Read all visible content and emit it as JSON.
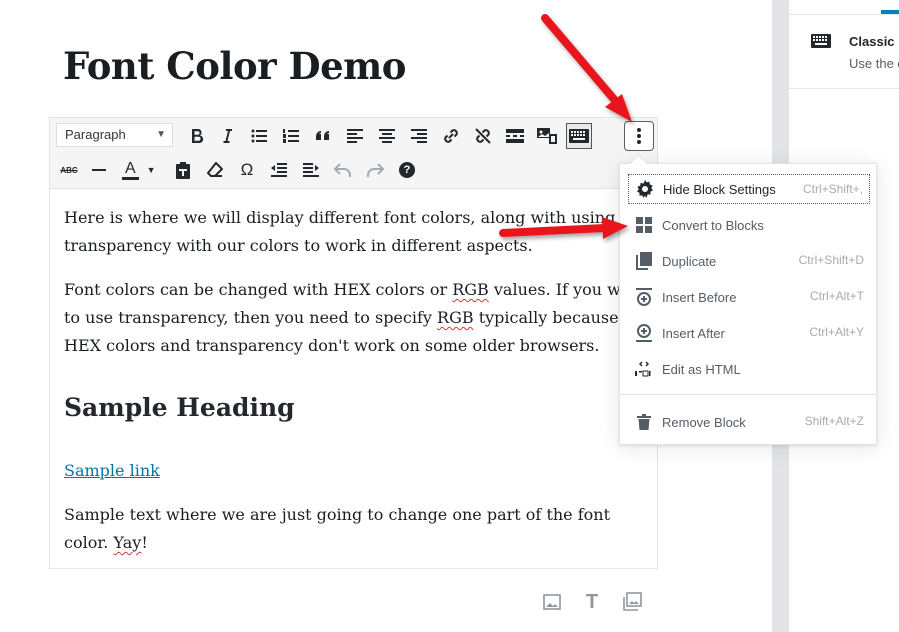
{
  "post": {
    "title": "Font Color Demo"
  },
  "toolbar": {
    "format_select": "Paragraph",
    "row1_icons": [
      "bold-icon",
      "italic-icon",
      "bullet-list-icon",
      "numbered-list-icon",
      "blockquote-icon",
      "align-left-icon",
      "align-center-icon",
      "align-right-icon",
      "link-icon",
      "unlink-icon",
      "read-more-icon",
      "media-icon",
      "toolbar-toggle-icon"
    ],
    "row2_icons": [
      "strikethrough-icon",
      "horizontal-line-icon",
      "text-color-icon",
      "paste-text-icon",
      "clear-formatting-icon",
      "special-character-icon",
      "outdent-icon",
      "indent-icon",
      "undo-icon",
      "redo-icon",
      "help-icon"
    ],
    "text_color_letter": "A",
    "omega_glyph": "Ω",
    "help_glyph": "?",
    "strike_label": "ABC"
  },
  "content": {
    "p1": "Here is where we will display different font colors, along with using transparency with our colors to work in different aspects.",
    "p2_a": "Font colors can be changed with HEX colors or ",
    "p2_rgb1": "RGB",
    "p2_b": " values. If you want to use transparency, then you need to specify ",
    "p2_rgb2": "RGB",
    "p2_c": " typically because HEX colors and transparency don't work on some older browsers.",
    "heading": "Sample Heading",
    "link": "Sample link",
    "p3_a": "Sample text where we are just going to change one part of the font color. ",
    "p3_yay": "Yay",
    "p3_b": "!"
  },
  "menu": {
    "items": [
      {
        "label": "Hide Block Settings",
        "shortcut": "Ctrl+Shift+,",
        "icon": "gear-icon"
      },
      {
        "label": "Convert to Blocks",
        "shortcut": "",
        "icon": "grid-blocks-icon"
      },
      {
        "label": "Duplicate",
        "shortcut": "Ctrl+Shift+D",
        "icon": "duplicate-icon"
      },
      {
        "label": "Insert Before",
        "shortcut": "Ctrl+Alt+T",
        "icon": "insert-before-icon"
      },
      {
        "label": "Insert After",
        "shortcut": "Ctrl+Alt+Y",
        "icon": "insert-after-icon"
      },
      {
        "label": "Edit as HTML",
        "shortcut": "",
        "icon": "html-icon"
      },
      {
        "label": "Remove Block",
        "shortcut": "Shift+Alt+Z",
        "icon": "trash-icon"
      }
    ]
  },
  "sidebar": {
    "block_title": "Classic",
    "block_desc": "Use the c",
    "block_icon": "keyboard-icon"
  },
  "inserter": {
    "icons": [
      "image-icon",
      "heading-icon",
      "gallery-icon"
    ],
    "heading_glyph": "T"
  },
  "colors": {
    "accent": "#0085ba",
    "link": "#0073aa",
    "annotation_arrow": "#e8191a"
  }
}
